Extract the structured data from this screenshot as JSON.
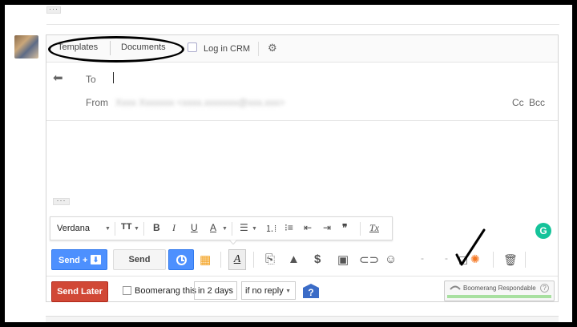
{
  "thread": {
    "collapsed_label": "···"
  },
  "ext_bar": {
    "templates_label": "Templates",
    "documents_label": "Documents",
    "log_crm_label": "Log in CRM",
    "gear_icon": "gear-icon"
  },
  "header": {
    "to_label": "To",
    "from_label": "From",
    "from_value": "Xxxx Xxxxxxx <xxxx.xxxxxxx@xxx.xxx>",
    "cc_label": "Cc",
    "bcc_label": "Bcc"
  },
  "body": {
    "quoted_dots": "···"
  },
  "format_bar": {
    "font_name": "Verdana",
    "size_icon": "TT",
    "bold": "B",
    "italic": "I",
    "underline": "U",
    "text_color": "A",
    "align": "≡",
    "numbered": "⅟",
    "quote": "❝❝",
    "clear": "Tx"
  },
  "grammarly": {
    "label": "G",
    "color": "#15c39a"
  },
  "toolbar": {
    "send_plus_label": "Send +",
    "send_label": "Send",
    "format_toggle": "A",
    "dollar": "$"
  },
  "boomerang": {
    "send_later_label": "Send Later",
    "boomerang_label": "Boomerang this",
    "days_value": "in 2 days",
    "condition_value": "if no reply",
    "help_label": "?",
    "responder_label": "Boomerang Respondable",
    "responder_help": "?"
  },
  "colors": {
    "send_blue": "#4d90fe",
    "send_later_red": "#d14836",
    "hubspot_orange": "#f57722"
  }
}
